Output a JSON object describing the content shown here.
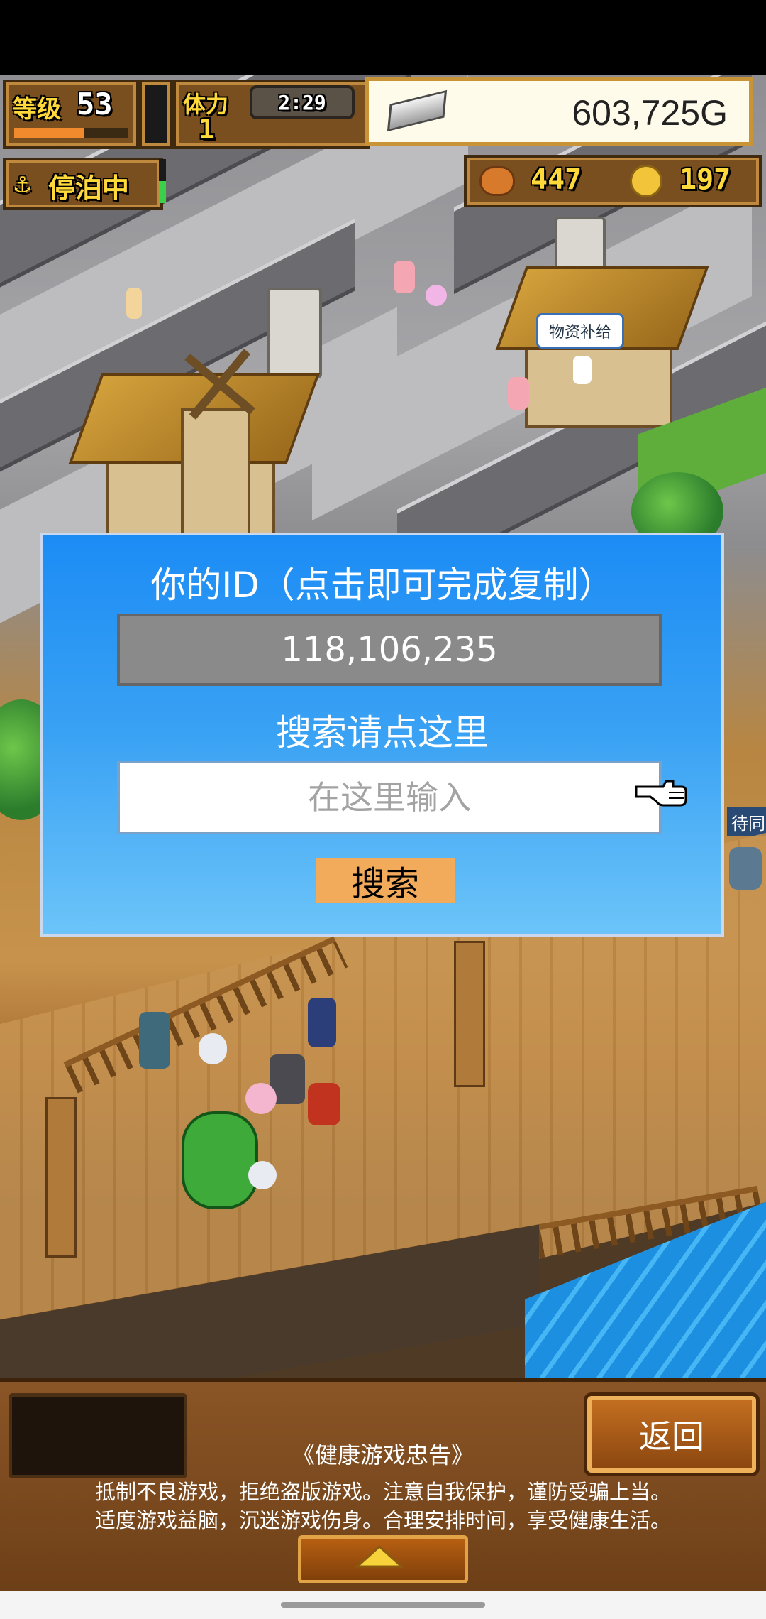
{
  "hud": {
    "level_label": "等级",
    "level_value": "53",
    "stamina_label": "体力",
    "stamina_value": "1",
    "timer": "2:29",
    "gold": "603,725G",
    "status": "停泊中",
    "food": "447",
    "medals": "197"
  },
  "scene": {
    "supply_label": "物资补给",
    "side_label": "待同"
  },
  "dialog": {
    "title": "你的ID（点击即可完成复制）",
    "id_value": "118,106,235",
    "search_label": "搜索请点这里",
    "input_placeholder": "在这里输入",
    "search_button": "搜索"
  },
  "bottom": {
    "back_button": "返回",
    "notice_title": "《健康游戏忠告》",
    "notice_line1": "抵制不良游戏，拒绝盗版游戏。注意自我保护，谨防受骗上当。",
    "notice_line2": "适度游戏益脑，沉迷游戏伤身。合理安排时间，享受健康生活。"
  },
  "colors": {
    "dialog_top": "#1c8cf5",
    "dialog_bottom": "#6cc4f9",
    "search_button": "#f2aa5b",
    "id_box": "#8a8a8a"
  }
}
